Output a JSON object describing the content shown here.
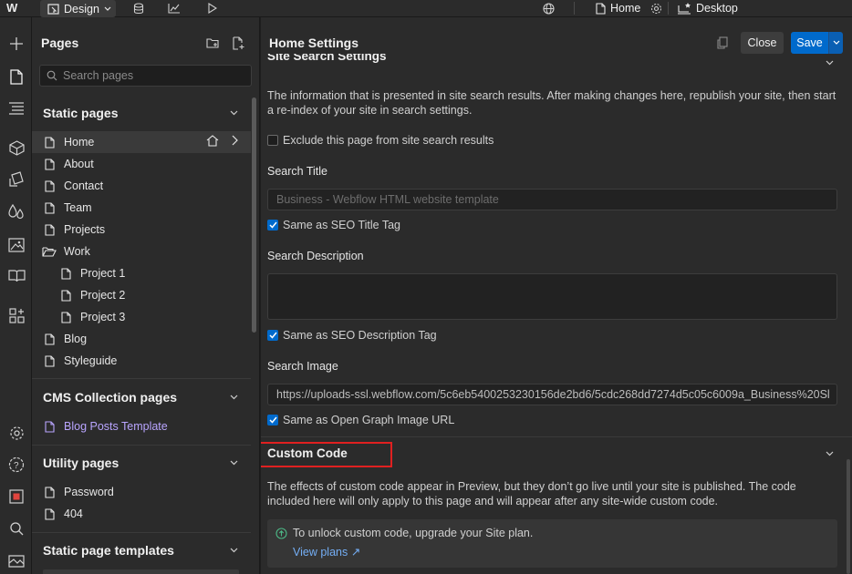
{
  "topbar": {
    "logo": "W",
    "mode_label": "Design",
    "icons": [
      "database-icon",
      "chart-icon",
      "play-icon",
      "globe-icon",
      "gear-icon"
    ],
    "current_page": "Home",
    "breakpoint": "Desktop"
  },
  "rail": {
    "icons": [
      "add-icon",
      "pages-icon",
      "navigator-icon",
      "components-icon",
      "styles-icon",
      "variables-icon",
      "assets-icon",
      "cms-icon",
      "apps-icon",
      "settings-icon",
      "help-icon",
      "record-icon",
      "search-icon",
      "feedback-icon"
    ]
  },
  "pages_panel": {
    "title": "Pages",
    "search_placeholder": "Search pages",
    "static_header": "Static pages",
    "static_pages": [
      {
        "label": "Home",
        "indent": 0,
        "icon": "page-icon",
        "selected": true
      },
      {
        "label": "About",
        "indent": 0,
        "icon": "page-icon"
      },
      {
        "label": "Contact",
        "indent": 0,
        "icon": "page-icon"
      },
      {
        "label": "Team",
        "indent": 0,
        "icon": "page-icon"
      },
      {
        "label": "Projects",
        "indent": 0,
        "icon": "page-icon"
      },
      {
        "label": "Work",
        "indent": 0,
        "icon": "folder-icon"
      },
      {
        "label": "Project 1",
        "indent": 1,
        "icon": "page-icon"
      },
      {
        "label": "Project 2",
        "indent": 1,
        "icon": "page-icon"
      },
      {
        "label": "Project 3",
        "indent": 1,
        "icon": "page-icon"
      },
      {
        "label": "Blog",
        "indent": 0,
        "icon": "page-icon"
      },
      {
        "label": "Styleguide",
        "indent": 0,
        "icon": "page-icon"
      }
    ],
    "cms_header": "CMS Collection pages",
    "cms_pages": [
      {
        "label": "Blog Posts Template"
      }
    ],
    "utility_header": "Utility pages",
    "utility_pages": [
      {
        "label": "Password"
      },
      {
        "label": "404"
      }
    ],
    "templates_header": "Static page templates"
  },
  "settings": {
    "title": "Home Settings",
    "close_label": "Close",
    "save_label": "Save",
    "site_search_heading": "Site Search Settings",
    "site_search_desc": "The information that is presented in site search results. After making changes here, republish your site, then start a re-index of your site in search settings.",
    "exclude_label": "Exclude this page from site search results",
    "search_title_label": "Search Title",
    "search_title_placeholder": "Business - Webflow HTML website template",
    "same_seo_title": "Same as SEO Title Tag",
    "search_desc_label": "Search Description",
    "same_seo_desc": "Same as SEO Description Tag",
    "search_image_label": "Search Image",
    "search_image_value": "https://uploads-ssl.webflow.com/5c6eb5400253230156de2bd6/5cdc268dd7274d5c05c6009a_Business%20Sl",
    "same_og_image": "Same as Open Graph Image URL",
    "custom_code_heading": "Custom Code",
    "custom_code_desc": "The effects of custom code appear in Preview, but they don’t go live until your site is published. The code included here will only apply to this page and will appear after any site-wide custom code.",
    "upgrade_msg": "To unlock custom code, upgrade your Site plan.",
    "view_plans": "View plans ↗"
  }
}
